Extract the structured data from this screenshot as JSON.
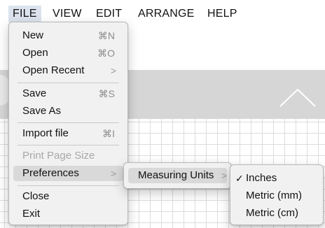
{
  "menubar": {
    "items": [
      "FILE",
      "VIEW",
      "EDIT",
      "ARRANGE",
      "HELP"
    ],
    "active": "FILE"
  },
  "file_menu": {
    "items": [
      {
        "label": "New",
        "shortcut": "⌘N"
      },
      {
        "label": "Open",
        "shortcut": "⌘O"
      },
      {
        "label": "Open Recent",
        "submenu_arrow": ">"
      },
      {
        "label": "Save",
        "shortcut": "⌘S"
      },
      {
        "label": "Save As"
      },
      {
        "label": "Import file",
        "shortcut": "⌘I"
      },
      {
        "label": "Print Page Size",
        "disabled": true
      },
      {
        "label": "Preferences",
        "submenu_arrow": ">",
        "highlighted": true
      },
      {
        "label": "Close"
      },
      {
        "label": "Exit"
      }
    ]
  },
  "preferences_menu": {
    "items": [
      {
        "label": "Measuring Units",
        "submenu_arrow": ">",
        "highlighted": true
      }
    ]
  },
  "measuring_units_menu": {
    "items": [
      {
        "label": "Inches",
        "checked": true,
        "check_mark": "✓"
      },
      {
        "label": "Metric (mm)"
      },
      {
        "label": "Metric (cm)"
      }
    ]
  },
  "colors": {
    "menubar_active": "#dce3ee",
    "menu_background": "#f1f1f1",
    "highlight": "#d9d9d9",
    "disabled_text": "#a8a8a8",
    "canvas_band": "#d6d6d6",
    "grid_line": "#dcdcdc"
  }
}
